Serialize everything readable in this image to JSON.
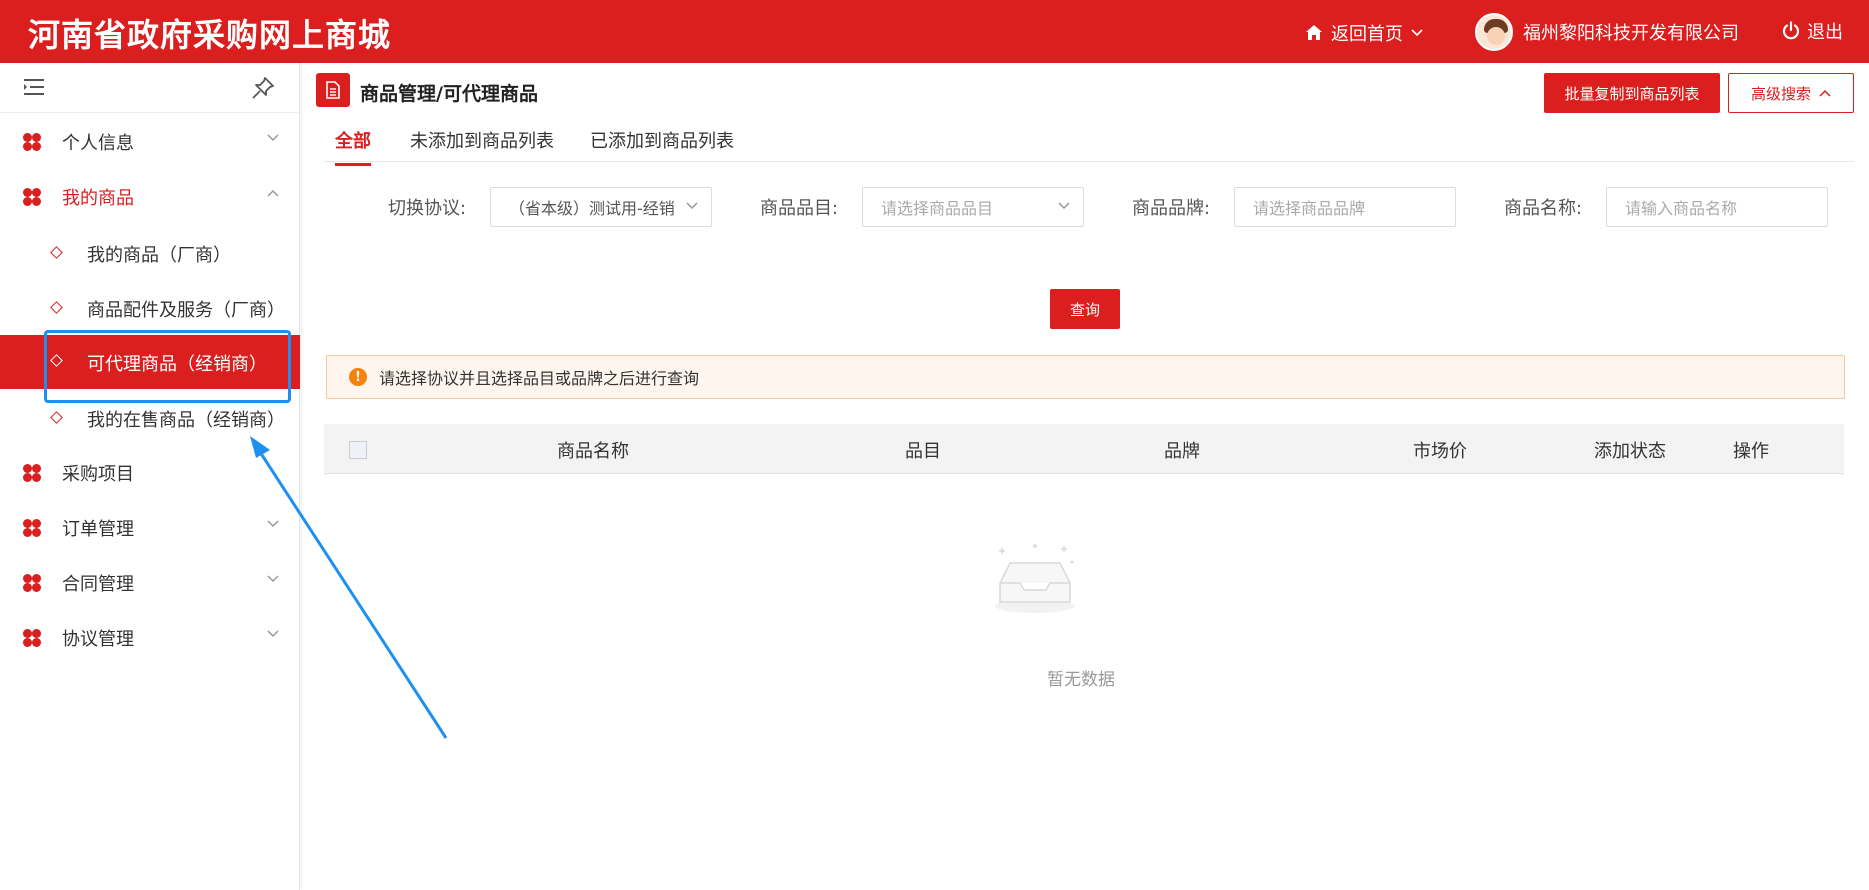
{
  "header": {
    "brand": "河南省政府采购网上商城",
    "home_label": "返回首页",
    "user_name": "福州黎阳科技开发有限公司",
    "logout_label": "退出"
  },
  "sidebar": {
    "items": [
      {
        "label": "个人信息"
      },
      {
        "label": "我的商品"
      },
      {
        "label": "采购项目"
      },
      {
        "label": "订单管理"
      },
      {
        "label": "合同管理"
      },
      {
        "label": "协议管理"
      }
    ],
    "sub_items": [
      {
        "label": "我的商品（厂商）"
      },
      {
        "label": "商品配件及服务（厂商）"
      },
      {
        "label": "可代理商品（经销商）"
      },
      {
        "label": "我的在售商品（经销商）"
      }
    ]
  },
  "main": {
    "title": "商品管理/可代理商品",
    "batch_copy_label": "批量复制到商品列表",
    "advanced_search_label": "高级搜索",
    "tabs": [
      {
        "label": "全部"
      },
      {
        "label": "未添加到商品列表"
      },
      {
        "label": "已添加到商品列表"
      }
    ],
    "filters": {
      "protocol_label": "切换协议:",
      "protocol_value": "（省本级）测试用-经销",
      "category_label": "商品品目:",
      "category_placeholder": "请选择商品品目",
      "brand_label": "商品品牌:",
      "brand_placeholder": "请选择商品品牌",
      "name_label": "商品名称:",
      "name_placeholder": "请输入商品名称"
    },
    "query_label": "查询",
    "alert_text": "请选择协议并且选择品目或品牌之后进行查询",
    "table": {
      "columns": [
        "商品名称",
        "品目",
        "品牌",
        "市场价",
        "添加状态",
        "操作"
      ]
    },
    "empty_text": "暂无数据"
  },
  "colors": {
    "brand_red": "#db1e1e",
    "annotation_blue": "#1e90f0",
    "alert_orange": "#f5820a"
  }
}
